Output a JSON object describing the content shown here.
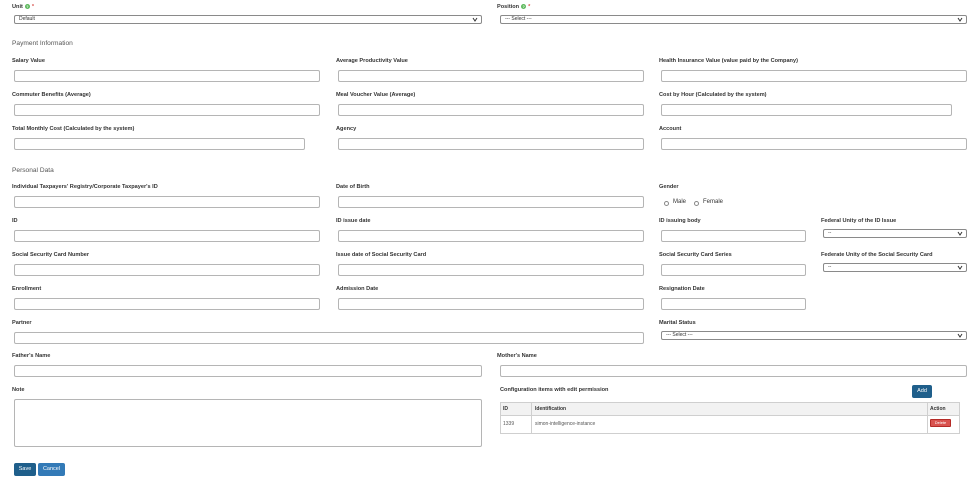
{
  "unit": {
    "label": "Unit",
    "required_mark": "*",
    "value": "Default"
  },
  "position": {
    "label": "Position",
    "required_mark": "*",
    "value": "--- Select ---"
  },
  "payment_section": {
    "title": "Payment Information"
  },
  "payment": {
    "salary_label": "Salary Value",
    "avg_productivity_label": "Average Productivity Value",
    "health_insurance_label": "Health Insurance Value (value paid by the Company)",
    "commuter_label": "Commuter Benefits (Average)",
    "meal_voucher_label": "Meal Voucher Value (Average)",
    "cost_by_hour_label": "Cost by Hour (Calculated by the system)",
    "total_monthly_label": "Total Monthly Cost (Calculated by the system)",
    "agency_label": "Agency",
    "account_label": "Account"
  },
  "personal_section": {
    "title": "Personal Data"
  },
  "personal": {
    "taxpayer_label": "Individual Taxpayers' Registry/Corporate Taxpayer's ID",
    "dob_label": "Date of Birth",
    "gender_label": "Gender",
    "gender_male": "Male",
    "gender_female": "Female",
    "id_label": "ID",
    "id_issue_date_label": "ID issue date",
    "id_issuing_body_label": "ID issuing body",
    "federal_unity_id_label": "Federal Unity of the ID Issue",
    "federal_unity_id_value": "--",
    "ssc_number_label": "Social Security Card Number",
    "ssc_issue_date_label": "Issue date of Social Security Card",
    "ssc_series_label": "Social Security Card Series",
    "federate_unity_ssc_label": "Federate Unity of the Social Security Card",
    "federate_unity_ssc_value": "--",
    "enrollment_label": "Enrollment",
    "admission_label": "Admission Date",
    "resignation_label": "Resignation Date",
    "partner_label": "Partner",
    "marital_label": "Marital Status",
    "marital_value": "--- Select ---",
    "father_label": "Father's Name",
    "mother_label": "Mother's Name",
    "note_label": "Note"
  },
  "config": {
    "title": "Configuration items with edit permission",
    "add_label": "Add",
    "columns": [
      "ID",
      "Identification",
      "Action"
    ],
    "rows": [
      {
        "id": "1339",
        "identification": "simon-intelligence-instance",
        "action": "Delete"
      }
    ]
  },
  "footer": {
    "save_label": "Save",
    "cancel_label": "Cancel"
  },
  "colors": {
    "primary_button": "#1f5f8b",
    "delete_button": "#d9534f",
    "info_icon": "#5cb85c"
  }
}
